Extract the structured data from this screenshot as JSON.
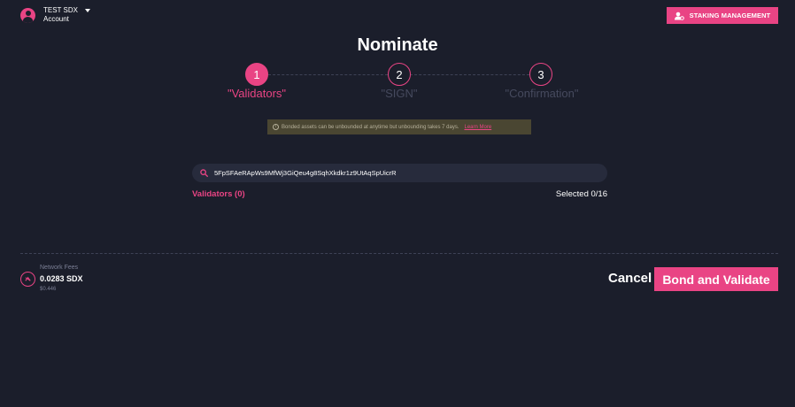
{
  "account": {
    "name": "TEST SDX",
    "subtitle": "Account"
  },
  "header": {
    "staking_button_label": "STAKING MANAGEMENT"
  },
  "page_title": "Nominate",
  "steps": [
    {
      "number": "1",
      "label": "\"Validators\"",
      "state": "active"
    },
    {
      "number": "2",
      "label": "\"SIGN\"",
      "state": "inactive"
    },
    {
      "number": "3",
      "label": "\"Confirmation\"",
      "state": "inactive"
    }
  ],
  "notice": {
    "text": "Bonded assets can be unbounded at anytime but unbounding takes 7 days.",
    "link_label": "Learn More"
  },
  "search": {
    "value": "5FpSFAeRApWs9MfWj3GiQeu4g8SqhXkdkr1z9UtAqSpUicrR"
  },
  "validators": {
    "count_label": "Validators (0)",
    "selected_label": "Selected 0/16"
  },
  "footer": {
    "fees_label": "Network Fees",
    "fees_amount": "0.0283 SDX",
    "fees_usd": "$0.446",
    "cancel_label": "Cancel",
    "bond_label": "Bond and Validate"
  },
  "colors": {
    "accent": "#e94484",
    "background": "#1b1e2b",
    "notice_bg": "#4a4632"
  }
}
